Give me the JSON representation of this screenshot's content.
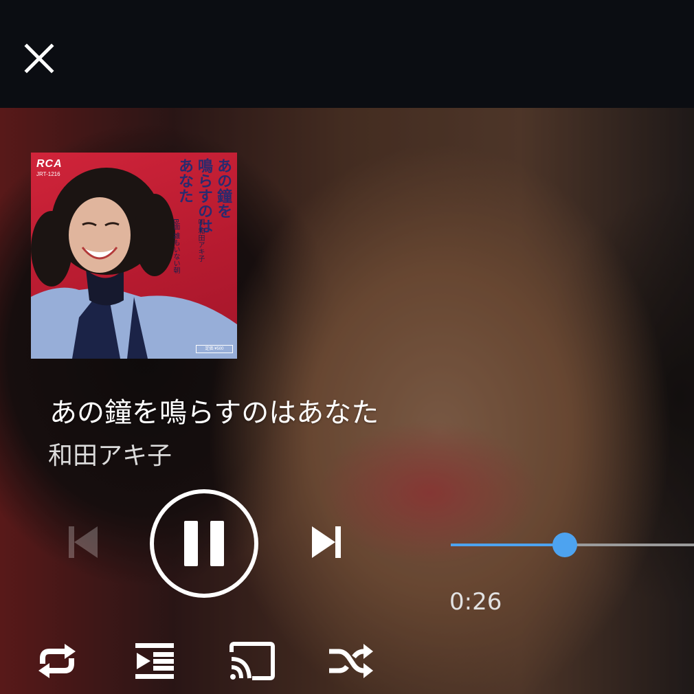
{
  "toolbar": {
    "close_icon": "close-icon"
  },
  "album_art": {
    "label": "RCA",
    "catalog": "JRT-1216",
    "title_lines": [
      "あの鐘を",
      "鳴らすのは",
      "あなた"
    ],
    "sub_lines": [
      "唄 和田アキ子",
      "B面 誰もいない朝"
    ]
  },
  "track": {
    "title": "あの鐘を鳴らすのはあなた",
    "artist": "和田アキ子"
  },
  "playback": {
    "state": "playing",
    "elapsed": "0:26",
    "progress_fraction": 0.47,
    "accent_color": "#4da3f0",
    "prev_enabled": false
  },
  "icons": {
    "prev": "skip-previous-icon",
    "play_pause": "pause-icon",
    "next": "skip-next-icon",
    "repeat": "repeat-icon",
    "queue": "queue-icon",
    "cast": "cast-icon",
    "shuffle": "shuffle-icon"
  }
}
